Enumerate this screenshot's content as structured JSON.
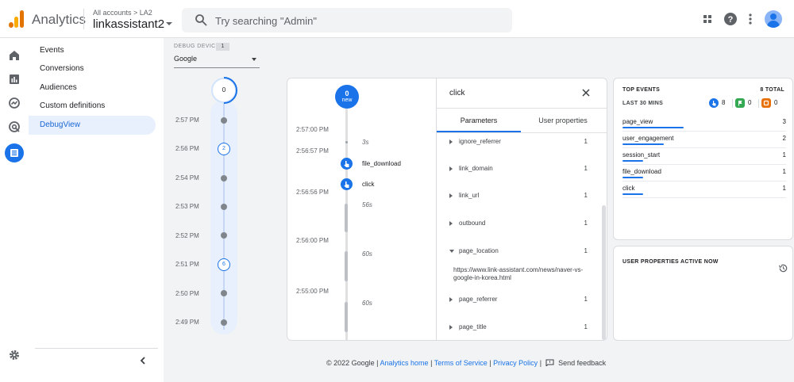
{
  "header": {
    "app_name": "Analytics",
    "account_path": "All accounts > LA2",
    "account_name": "linkassistant2",
    "search_placeholder": "Try searching \"Admin\""
  },
  "subnav": {
    "items": [
      {
        "label": "Events"
      },
      {
        "label": "Conversions"
      },
      {
        "label": "Audiences"
      },
      {
        "label": "Custom definitions"
      },
      {
        "label": "DebugView",
        "active": true
      }
    ]
  },
  "debug_device": {
    "label": "DEBUG DEVICE",
    "count": "1",
    "selected": "Google"
  },
  "minutes": {
    "top_count": "0",
    "rows": [
      {
        "time": "2:57 PM",
        "count": null
      },
      {
        "time": "2:56 PM",
        "count": "2"
      },
      {
        "time": "2:54 PM",
        "count": null
      },
      {
        "time": "2:53 PM",
        "count": null
      },
      {
        "time": "2:52 PM",
        "count": null
      },
      {
        "time": "2:51 PM",
        "count": "6"
      },
      {
        "time": "2:50 PM",
        "count": null
      },
      {
        "time": "2:49 PM",
        "count": null
      }
    ]
  },
  "seconds": {
    "new_count": "0",
    "new_label": "new",
    "times": [
      "2:57:00 PM",
      "2:56:57 PM",
      "2:56:56 PM",
      "2:56:00 PM",
      "2:55:00 PM"
    ],
    "gaps": [
      "3s",
      "56s",
      "60s",
      "60s"
    ],
    "events": [
      "file_download",
      "click"
    ]
  },
  "detail": {
    "title": "click",
    "tabs": [
      "Parameters",
      "User properties"
    ],
    "params": [
      {
        "name": "ignore_referrer",
        "count": "1",
        "expanded": false
      },
      {
        "name": "link_domain",
        "count": "1",
        "expanded": false
      },
      {
        "name": "link_url",
        "count": "1",
        "expanded": false
      },
      {
        "name": "outbound",
        "count": "1",
        "expanded": false
      },
      {
        "name": "page_location",
        "count": "1",
        "expanded": true
      },
      {
        "name": "page_referrer",
        "count": "1",
        "expanded": false
      },
      {
        "name": "page_title",
        "count": "1",
        "expanded": false
      }
    ],
    "page_location_value": "https://www.link-assistant.com/news/naver-vs-google-in-korea.html"
  },
  "top_events": {
    "title": "TOP EVENTS",
    "total": "8 TOTAL",
    "subtitle": "LAST 30 MINS",
    "counts": {
      "events": "8",
      "conversions": "0",
      "errors": "0"
    },
    "colors": {
      "events": "#1a73e8",
      "conversions": "#34a853",
      "errors": "#e8710a"
    },
    "rows": [
      {
        "name": "page_view",
        "count": "3",
        "share": 0.375
      },
      {
        "name": "user_engagement",
        "count": "2",
        "share": 0.25
      },
      {
        "name": "session_start",
        "count": "1",
        "share": 0.125
      },
      {
        "name": "file_download",
        "count": "1",
        "share": 0.125
      },
      {
        "name": "click",
        "count": "1",
        "share": 0.125
      }
    ]
  },
  "user_properties": {
    "title": "USER PROPERTIES ACTIVE NOW"
  },
  "footer": {
    "copyright": "© 2022 Google |",
    "analytics_home": "Analytics home",
    "terms": "Terms of Service",
    "privacy": "Privacy Policy",
    "feedback": "Send feedback",
    "sep": "|"
  }
}
